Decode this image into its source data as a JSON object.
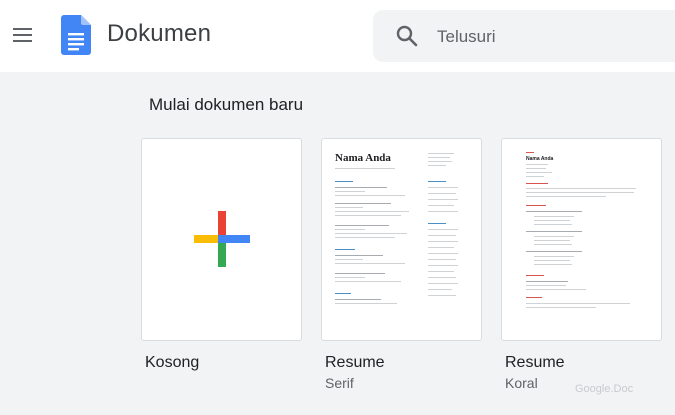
{
  "header": {
    "app_title": "Dokumen",
    "search_placeholder": "Telusuri"
  },
  "section": {
    "title": "Mulai dokumen baru"
  },
  "templates": [
    {
      "label": "Kosong",
      "sublabel": ""
    },
    {
      "label": "Resume",
      "sublabel": "Serif",
      "thumb_name": "Nama Anda"
    },
    {
      "label": "Resume",
      "sublabel": "Koral",
      "thumb_name": "Nama Anda"
    }
  ],
  "watermark": "Google.Doc",
  "colors": {
    "docs_blue": "#4285f4",
    "plus_blue": "#4285f4",
    "plus_red": "#ea4335",
    "plus_yellow": "#fbbc04",
    "plus_green": "#34a853",
    "koral_accent": "#d9534f",
    "serif_accent": "#4a90c8"
  },
  "icons": {
    "menu": "hamburger-menu-icon",
    "logo": "docs-logo-icon",
    "search": "search-icon",
    "blank": "plus-icon"
  }
}
